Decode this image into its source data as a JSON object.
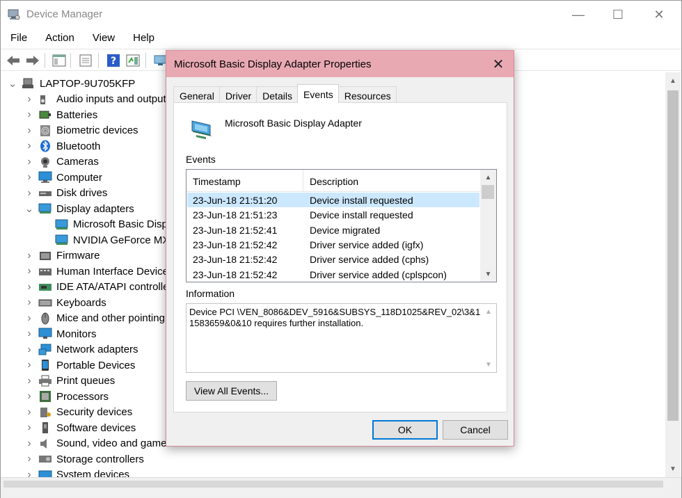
{
  "window": {
    "title": "Device Manager",
    "min_glyph": "—",
    "max_glyph": "☐",
    "close_glyph": "✕"
  },
  "menu": [
    "File",
    "Action",
    "View",
    "Help"
  ],
  "toolbar_icons": [
    "back-arrow-icon",
    "forward-arrow-icon",
    "show-hide-console-tree-icon",
    "properties-icon",
    "help-icon",
    "action-pane-icon",
    "update-driver-icon"
  ],
  "tree": {
    "root": "LAPTOP-9U705KFP",
    "items": [
      {
        "label": "Audio inputs and outputs",
        "icon": "speaker-icon",
        "expanded": false
      },
      {
        "label": "Batteries",
        "icon": "battery-icon",
        "expanded": false
      },
      {
        "label": "Biometric devices",
        "icon": "fingerprint-icon",
        "expanded": false
      },
      {
        "label": "Bluetooth",
        "icon": "bluetooth-icon",
        "expanded": false
      },
      {
        "label": "Cameras",
        "icon": "camera-icon",
        "expanded": false
      },
      {
        "label": "Computer",
        "icon": "computer-icon",
        "expanded": false
      },
      {
        "label": "Disk drives",
        "icon": "disk-drive-icon",
        "expanded": false
      },
      {
        "label": "Display adapters",
        "icon": "display-adapter-icon",
        "expanded": true,
        "children": [
          "Microsoft Basic Display Adapter",
          "NVIDIA GeForce MX150"
        ]
      },
      {
        "label": "Firmware",
        "icon": "firmware-icon",
        "expanded": false
      },
      {
        "label": "Human Interface Devices",
        "icon": "hid-icon",
        "expanded": false
      },
      {
        "label": "IDE ATA/ATAPI controllers",
        "icon": "ide-controller-icon",
        "expanded": false
      },
      {
        "label": "Keyboards",
        "icon": "keyboard-icon",
        "expanded": false
      },
      {
        "label": "Mice and other pointing devices",
        "icon": "mouse-icon",
        "expanded": false
      },
      {
        "label": "Monitors",
        "icon": "monitor-icon",
        "expanded": false
      },
      {
        "label": "Network adapters",
        "icon": "network-adapter-icon",
        "expanded": false
      },
      {
        "label": "Portable Devices",
        "icon": "portable-device-icon",
        "expanded": false
      },
      {
        "label": "Print queues",
        "icon": "printer-icon",
        "expanded": false
      },
      {
        "label": "Processors",
        "icon": "processor-icon",
        "expanded": false
      },
      {
        "label": "Security devices",
        "icon": "security-key-icon",
        "expanded": false
      },
      {
        "label": "Software devices",
        "icon": "software-device-icon",
        "expanded": false
      },
      {
        "label": "Sound, video and game controllers",
        "icon": "sound-icon",
        "expanded": false
      },
      {
        "label": "Storage controllers",
        "icon": "storage-controller-icon",
        "expanded": false
      },
      {
        "label": "System devices",
        "icon": "system-device-icon",
        "expanded": false
      }
    ]
  },
  "dialog": {
    "title": "Microsoft Basic Display Adapter Properties",
    "close_glyph": "✕",
    "tabs": [
      "General",
      "Driver",
      "Details",
      "Events",
      "Resources"
    ],
    "active_tab": "Events",
    "device_name": "Microsoft Basic Display Adapter",
    "events_label": "Events",
    "columns": [
      "Timestamp",
      "Description"
    ],
    "events": [
      {
        "timestamp": "23-Jun-18 21:51:20",
        "description": "Device install requested",
        "selected": true
      },
      {
        "timestamp": "23-Jun-18 21:51:23",
        "description": "Device install requested",
        "selected": false
      },
      {
        "timestamp": "23-Jun-18 21:52:41",
        "description": "Device migrated",
        "selected": false
      },
      {
        "timestamp": "23-Jun-18 21:52:42",
        "description": "Driver service added (igfx)",
        "selected": false
      },
      {
        "timestamp": "23-Jun-18 21:52:42",
        "description": "Driver service added (cphs)",
        "selected": false
      },
      {
        "timestamp": "23-Jun-18 21:52:42",
        "description": "Driver service added (cplspcon)",
        "selected": false
      }
    ],
    "information_label": "Information",
    "information_text": "Device PCI \\VEN_8086&DEV_5916&SUBSYS_118D1025&REV_02\\3&11583659&0&10 requires further installation.",
    "view_all_label": "View All Events...",
    "ok_label": "OK",
    "cancel_label": "Cancel"
  },
  "colors": {
    "dialog_title_bg": "#e9a9b3",
    "selection": "#cce8ff",
    "accent": "#0078d7"
  }
}
